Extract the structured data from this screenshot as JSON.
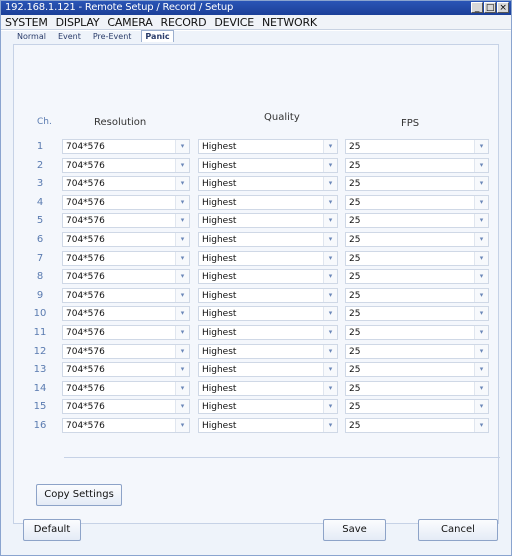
{
  "window": {
    "title": "192.168.1.121 - Remote Setup / Record / Setup"
  },
  "menu": [
    "SYSTEM",
    "DISPLAY",
    "CAMERA",
    "RECORD",
    "DEVICE",
    "NETWORK"
  ],
  "tabs": [
    {
      "label": "Normal",
      "active": false
    },
    {
      "label": "Event",
      "active": false
    },
    {
      "label": "Pre-Event",
      "active": false
    },
    {
      "label": "Panic",
      "active": true
    }
  ],
  "columns": {
    "ch": "Ch.",
    "resolution": "Resolution",
    "quality": "Quality",
    "fps": "FPS"
  },
  "rows": [
    {
      "ch": "1",
      "resolution": "704*576",
      "quality": "Highest",
      "fps": "25"
    },
    {
      "ch": "2",
      "resolution": "704*576",
      "quality": "Highest",
      "fps": "25"
    },
    {
      "ch": "3",
      "resolution": "704*576",
      "quality": "Highest",
      "fps": "25"
    },
    {
      "ch": "4",
      "resolution": "704*576",
      "quality": "Highest",
      "fps": "25"
    },
    {
      "ch": "5",
      "resolution": "704*576",
      "quality": "Highest",
      "fps": "25"
    },
    {
      "ch": "6",
      "resolution": "704*576",
      "quality": "Highest",
      "fps": "25"
    },
    {
      "ch": "7",
      "resolution": "704*576",
      "quality": "Highest",
      "fps": "25"
    },
    {
      "ch": "8",
      "resolution": "704*576",
      "quality": "Highest",
      "fps": "25"
    },
    {
      "ch": "9",
      "resolution": "704*576",
      "quality": "Highest",
      "fps": "25"
    },
    {
      "ch": "10",
      "resolution": "704*576",
      "quality": "Highest",
      "fps": "25"
    },
    {
      "ch": "11",
      "resolution": "704*576",
      "quality": "Highest",
      "fps": "25"
    },
    {
      "ch": "12",
      "resolution": "704*576",
      "quality": "Highest",
      "fps": "25"
    },
    {
      "ch": "13",
      "resolution": "704*576",
      "quality": "Highest",
      "fps": "25"
    },
    {
      "ch": "14",
      "resolution": "704*576",
      "quality": "Highest",
      "fps": "25"
    },
    {
      "ch": "15",
      "resolution": "704*576",
      "quality": "Highest",
      "fps": "25"
    },
    {
      "ch": "16",
      "resolution": "704*576",
      "quality": "Highest",
      "fps": "25"
    }
  ],
  "buttons": {
    "copy_settings": "Copy Settings",
    "default": "Default",
    "save": "Save",
    "cancel": "Cancel"
  },
  "icons": {
    "minimize": "minimize-icon",
    "maximize": "maximize-icon",
    "close": "close-icon",
    "dropdown": "chevron-down-icon"
  },
  "colors": {
    "titlebar": "#1b3f98",
    "background": "#eef3fa",
    "channel_number": "#5a7bb0"
  }
}
